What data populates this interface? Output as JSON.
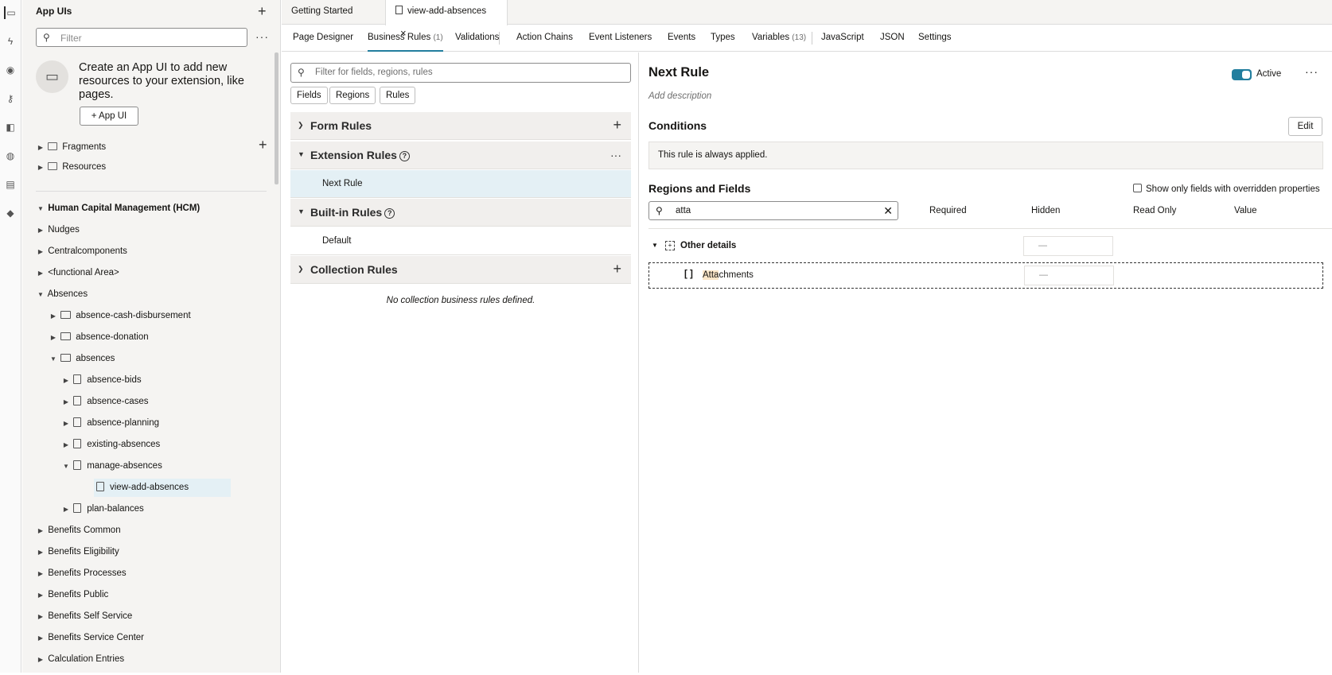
{
  "nav": {
    "title": "App UIs",
    "filter_placeholder": "Filter",
    "promo_text": "Create an App UI to add new resources to your extension, like pages.",
    "appui_button": "App UI",
    "top_items": [
      "Fragments",
      "Resources"
    ],
    "group_title": "Human Capital Management (HCM)",
    "tree": [
      {
        "label": "Nudges"
      },
      {
        "label": "Centralcomponents"
      },
      {
        "label": "<functional Area>"
      },
      {
        "label": "Absences"
      },
      {
        "label": "absence-cash-disbursement"
      },
      {
        "label": "absence-donation"
      },
      {
        "label": "absences"
      },
      {
        "label": "absence-bids"
      },
      {
        "label": "absence-cases"
      },
      {
        "label": "absence-planning"
      },
      {
        "label": "existing-absences"
      },
      {
        "label": "manage-absences"
      },
      {
        "label": "view-add-absences"
      },
      {
        "label": "plan-balances"
      },
      {
        "label": "Benefits Common"
      },
      {
        "label": "Benefits Eligibility"
      },
      {
        "label": "Benefits Processes"
      },
      {
        "label": "Benefits Public"
      },
      {
        "label": "Benefits Self Service"
      },
      {
        "label": "Benefits Service Center"
      },
      {
        "label": "Calculation Entries"
      }
    ]
  },
  "tabs": {
    "items": [
      {
        "label": "Getting Started"
      },
      {
        "label": "view-add-absences"
      }
    ]
  },
  "subnav": {
    "items": [
      {
        "label": "Page Designer",
        "count": ""
      },
      {
        "label": "Business Rules",
        "count": "(1)"
      },
      {
        "label": "Validations",
        "count": ""
      },
      {
        "label": "Action Chains",
        "count": ""
      },
      {
        "label": "Event Listeners",
        "count": ""
      },
      {
        "label": "Events",
        "count": ""
      },
      {
        "label": "Types",
        "count": ""
      },
      {
        "label": "Variables",
        "count": "(13)"
      },
      {
        "label": "JavaScript",
        "count": ""
      },
      {
        "label": "JSON",
        "count": ""
      },
      {
        "label": "Settings",
        "count": ""
      }
    ]
  },
  "rules": {
    "filter_placeholder": "Filter for fields, regions, rules",
    "chips": [
      "Fields",
      "Regions",
      "Rules"
    ],
    "sections": [
      {
        "label": "Form Rules"
      },
      {
        "label": "Extension Rules"
      },
      {
        "label": "Built-in Rules"
      },
      {
        "label": "Collection Rules"
      }
    ],
    "extension_items": [
      "Next Rule"
    ],
    "builtin_items": [
      "Default"
    ],
    "collection_empty": "No collection business rules defined."
  },
  "detail": {
    "title": "Next Rule",
    "active_label": "Active",
    "add_description": "Add description",
    "conditions_heading": "Conditions",
    "edit_button": "Edit",
    "condition_text": "This rule is always applied.",
    "regions_heading": "Regions and Fields",
    "override_checkbox": "Show only fields with overridden properties",
    "search_value": "atta",
    "columns": [
      "Required",
      "Hidden",
      "Read Only",
      "Value"
    ],
    "rows": [
      {
        "label": "Other details",
        "hidden": "—"
      },
      {
        "label_match": "Atta",
        "label_rest": "chments",
        "hidden": "—"
      }
    ]
  },
  "colors": {
    "accent": "#227e9e",
    "selected_row": "#e4f0f5",
    "highlight": "#fbe6c8"
  }
}
